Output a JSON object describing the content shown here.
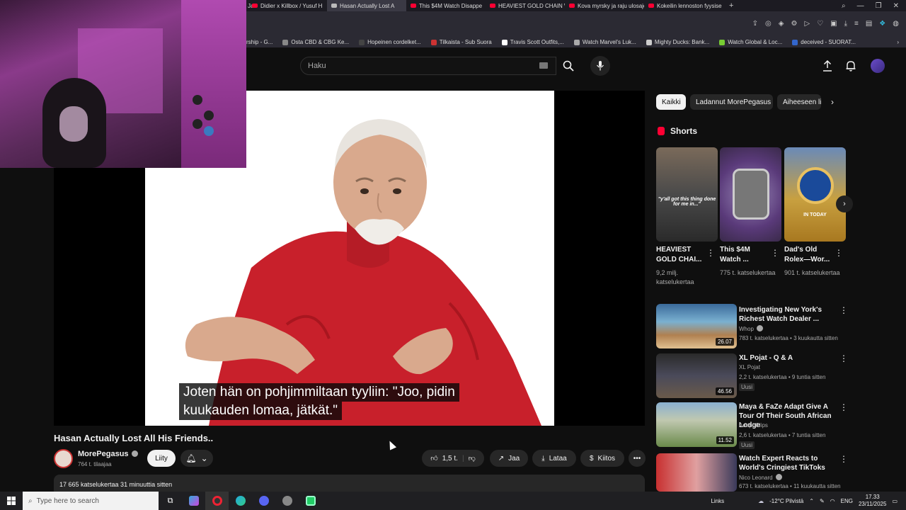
{
  "browser": {
    "tabs": [
      {
        "label": "Didier x Killbox / Yusuf H",
        "active": false
      },
      {
        "label": "Hasan Actually Lost A",
        "active": true
      },
      {
        "label": "This $4M Watch Disappe",
        "active": false
      },
      {
        "label": "HEAVIEST GOLD CHAIN W",
        "active": false
      },
      {
        "label": "Kova myrsky ja raju ulosajo",
        "active": false
      },
      {
        "label": "Kokeilin lennoston fyysise",
        "active": false
      }
    ],
    "tab_partial_left": "Jac",
    "new_tab": "+",
    "bookmarks": [
      "rship - G...",
      "Osta CBD & CBG Ke...",
      "Hopeinen cordelket...",
      "Tilkaista - Sub Suora",
      "Travis Scott Outfits,...",
      "Watch Marvel's Luk...",
      "Mighty Ducks: Bank...",
      "Watch Global & Loc...",
      "deceived - SUORAT..."
    ]
  },
  "header": {
    "search_placeholder": "Haku"
  },
  "video": {
    "subtitle_line1": "Joten hän on pohjimmiltaan tyyliin: \"Joo, pidin",
    "subtitle_line2": "kuukauden lomaa, jätkät.\"",
    "title": "Hasan Actually Lost All His Friends..",
    "channel_name": "MorePegasus",
    "subscribers": "764 t. tilaajaa",
    "join_label": "Liity",
    "like_count": "1,5 t.",
    "share_label": "Jaa",
    "download_label": "Lataa",
    "thanks_label": "Kiitos",
    "views_line": "17 665 katselukertaa  31 minuuttia sitten"
  },
  "chips": [
    "Kaikki",
    "Ladannut MorePegasus",
    "Aiheeseen li"
  ],
  "shorts": {
    "heading": "Shorts",
    "items": [
      {
        "title": "HEAVIEST GOLD CHAI...",
        "views": "9,2 milj. katselukertaa",
        "thumb_text": "\"y'all got this thing done for me in...\""
      },
      {
        "title": "This $4M Watch ...",
        "views": "775 t. katselukertaa",
        "thumb_text": ""
      },
      {
        "title": "Dad's Old Rolex—Wor...",
        "views": "901 t. katselukertaa",
        "thumb_text": "IN TODAY"
      }
    ]
  },
  "recommendations": [
    {
      "title": "Investigating New York's Richest Watch Dealer ...",
      "channel": "Whop",
      "meta": "783 t. katselukertaa • 3 kuukautta sitten",
      "duration": "26.07",
      "new": ""
    },
    {
      "title": "XL Pojat - Q & A",
      "channel": "XL Pojat",
      "meta": "2,2 t. katselukertaa • 9 tuntia sitten",
      "duration": "46.56",
      "new": "Uusi"
    },
    {
      "title": "Maya & FaZe Adapt Give A Tour Of Their South African Lodge",
      "channel": "Adapt Clips",
      "meta": "2,6 t. katselukertaa • 7 tuntia sitten",
      "duration": "11.52",
      "new": "Uusi"
    },
    {
      "title": "Watch Expert Reacts to World's Cringiest TikToks",
      "channel": "Nico Leonard",
      "meta": "673 t. katselukertaa • 11 kuukautta sitten",
      "duration": "",
      "new": ""
    }
  ],
  "taskbar": {
    "search_placeholder": "Type here to search",
    "links_label": "Links",
    "weather": "-12°C  Pilvistä",
    "language": "ENG",
    "time": "17.33",
    "date": "23/11/2025"
  }
}
